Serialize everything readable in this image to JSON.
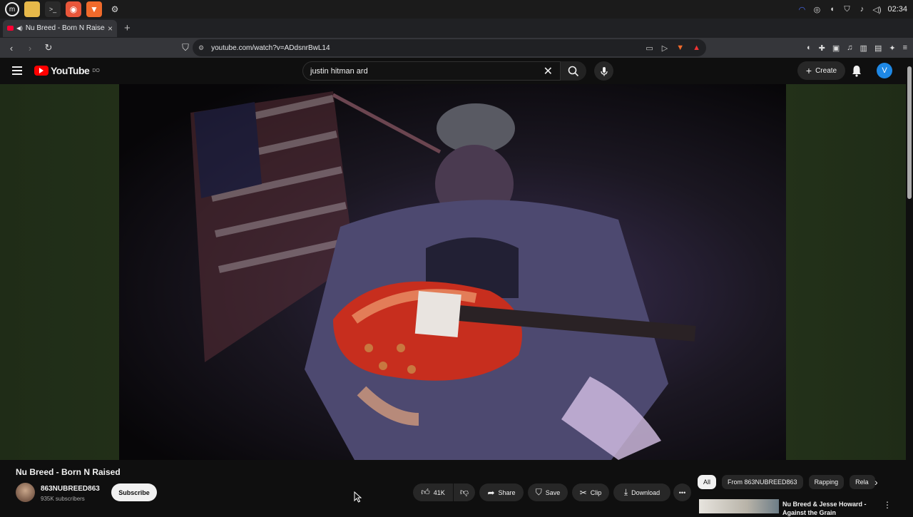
{
  "taskbar": {
    "apps": [
      "mint-menu",
      "files",
      "terminal",
      "firefox",
      "brave",
      "settings"
    ],
    "clock": "02:34"
  },
  "browser": {
    "tab_title": "Nu Breed - Born N Raised",
    "url": "youtube.com/watch?v=ADdsnrBwL14"
  },
  "youtube": {
    "logo_text": "YouTube",
    "logo_sup": "DO",
    "search_value": "justin hitman ard",
    "create_label": "Create",
    "avatar_letter": "V"
  },
  "video": {
    "title": "Nu Breed - Born N Raised",
    "channel": "863NUBREED863",
    "subscribers": "935K subscribers",
    "subscribe_label": "Subscribe",
    "likes": "41K",
    "share_label": "Share",
    "save_label": "Save",
    "clip_label": "Clip",
    "download_label": "Download"
  },
  "related": {
    "chips": [
      "All",
      "From 863NUBREED863",
      "Rapping",
      "Rela"
    ],
    "card_title": "Nu Breed & Jesse Howard - Against the Grain"
  }
}
